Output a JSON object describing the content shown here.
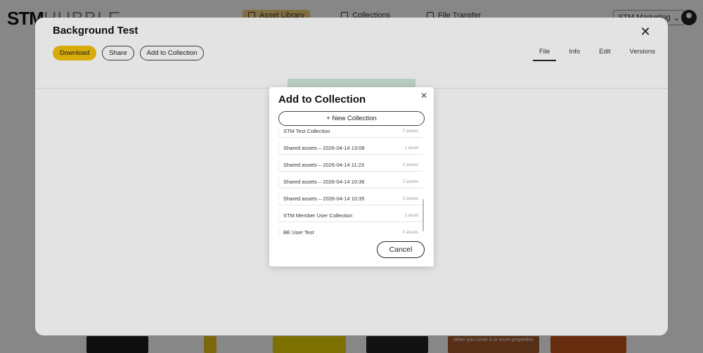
{
  "app": {
    "logo_bold": "STM",
    "logo_light": "HUBBLE",
    "nav": [
      {
        "label": "Asset Library",
        "icon": "grid-icon"
      },
      {
        "label": "Collections",
        "icon": "collections-icon"
      },
      {
        "label": "File Transfer",
        "icon": "file-transfer-icon"
      }
    ],
    "org": "STM Marketing",
    "org_caret": "⌄"
  },
  "asset": {
    "title": "Background Test",
    "close_symbol": "✕",
    "actions": {
      "download": "Download",
      "share": "Share",
      "add_to_collection": "Add to Collection"
    },
    "tabs": [
      "File",
      "Info",
      "Edit",
      "Versions"
    ],
    "active_tab": "File",
    "preview_color": "#cfe4d8"
  },
  "modal": {
    "title": "Add to Collection",
    "close_symbol": "✕",
    "new_collection": "+ New Collection",
    "cancel": "Cancel",
    "collections": [
      {
        "name": "STM Test Collection",
        "count": "7 assets"
      },
      {
        "name": "Shared assets – 2026-04-14 13:08",
        "count": "1 asset"
      },
      {
        "name": "Shared assets – 2026-04-14 11:23",
        "count": "2 assets"
      },
      {
        "name": "Shared assets – 2026-04-14 10:36",
        "count": "2 assets"
      },
      {
        "name": "Shared assets – 2026-04-14 10:35",
        "count": "3 assets"
      },
      {
        "name": "STM Member User Collection",
        "count": "1 asset"
      },
      {
        "name": "BE User Test",
        "count": "0 assets"
      }
    ]
  },
  "thumbnails": {
    "caption": "when you cover it or more properties"
  },
  "colors": {
    "accent": "#f2c00c",
    "overlay": "rgba(0,0,0,0.47)"
  }
}
